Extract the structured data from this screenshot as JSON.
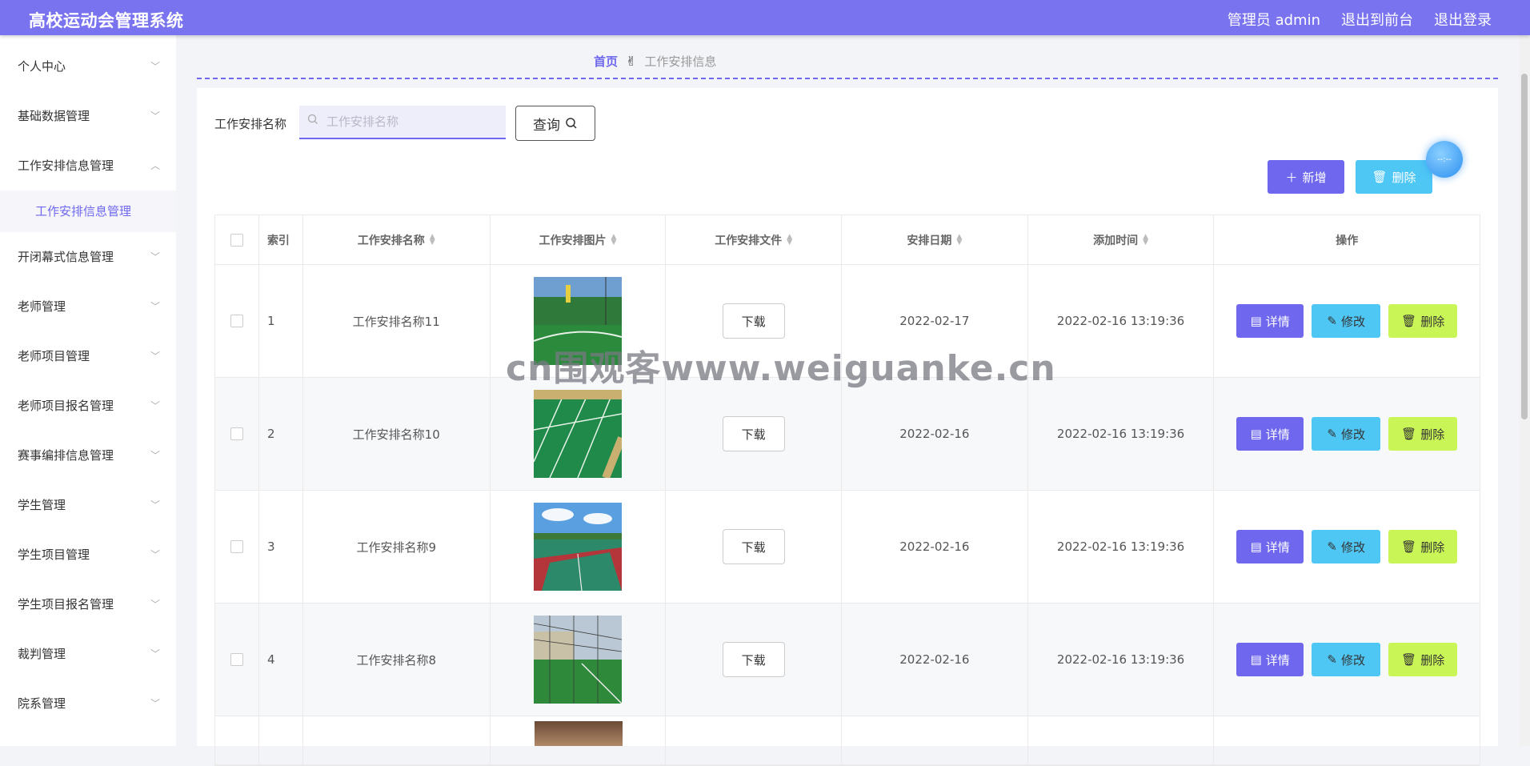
{
  "header": {
    "title": "高校运动会管理系统",
    "admin": "管理员 admin",
    "exit_front": "退出到前台",
    "logout": "退出登录"
  },
  "sidebar": {
    "items": [
      {
        "label": "个人中心"
      },
      {
        "label": "基础数据管理"
      },
      {
        "label": "工作安排信息管理"
      },
      {
        "label": "工作安排信息管理"
      },
      {
        "label": "开闭幕式信息管理"
      },
      {
        "label": "老师管理"
      },
      {
        "label": "老师项目管理"
      },
      {
        "label": "老师项目报名管理"
      },
      {
        "label": "赛事编排信息管理"
      },
      {
        "label": "学生管理"
      },
      {
        "label": "学生项目管理"
      },
      {
        "label": "学生项目报名管理"
      },
      {
        "label": "裁判管理"
      },
      {
        "label": "院系管理"
      }
    ]
  },
  "breadcrumb": {
    "home": "首页",
    "current": "工作安排信息"
  },
  "search": {
    "label": "工作安排名称",
    "placeholder": "工作安排名称",
    "button": "查询"
  },
  "toolbar": {
    "add": "新增",
    "delete": "删除"
  },
  "table": {
    "headers": [
      "索引",
      "工作安排名称",
      "工作安排图片",
      "工作安排文件",
      "安排日期",
      "添加时间",
      "操作"
    ],
    "rows": [
      {
        "index": "1",
        "name": "工作安排名称11",
        "file": "下载",
        "date": "2022-02-17",
        "added": "2022-02-16 13:19:36"
      },
      {
        "index": "2",
        "name": "工作安排名称10",
        "file": "下载",
        "date": "2022-02-16",
        "added": "2022-02-16 13:19:36"
      },
      {
        "index": "3",
        "name": "工作安排名称9",
        "file": "下载",
        "date": "2022-02-16",
        "added": "2022-02-16 13:19:36"
      },
      {
        "index": "4",
        "name": "工作安排名称8",
        "file": "下载",
        "date": "2022-02-16",
        "added": "2022-02-16 13:19:36"
      }
    ],
    "ops": {
      "detail": "详情",
      "edit": "修改",
      "delete": "删除"
    }
  },
  "watermark": "cn围观客www.weiguanke.cn",
  "colors": {
    "accent": "#6f68ee",
    "header": "#7a73ef",
    "info": "#4fc7f5",
    "lime": "#c9f556"
  }
}
